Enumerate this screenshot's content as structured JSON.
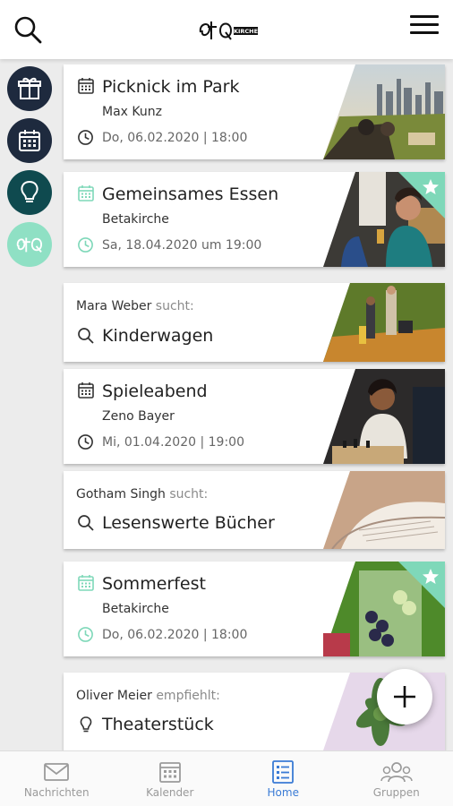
{
  "colors": {
    "accent": "#3a7bd5",
    "mint": "#7fd8b9",
    "navy": "#1e2a3e",
    "teal": "#0f4a4f",
    "logo_green": "#8fe0c4"
  },
  "header": {
    "search_icon": "search-icon",
    "logo_badge": "KIRCHE",
    "menu_icon": "menu-icon"
  },
  "rail": [
    {
      "icon": "gift-icon"
    },
    {
      "icon": "calendar-icon"
    },
    {
      "icon": "lightbulb-icon"
    },
    {
      "icon": "logo-icon"
    }
  ],
  "cards": {
    "picknick": {
      "title": "Picknick im Park",
      "subtitle": "Max Kunz",
      "when": "Do, 06.02.2020 | 18:00"
    },
    "essen": {
      "title": "Gemeinsames Essen",
      "subtitle": "Betakirche",
      "when": "Sa, 18.04.2020 um 19:00",
      "starred": true
    },
    "kinderwagen": {
      "author": "Mara Weber",
      "verb": "sucht:",
      "title": "Kinderwagen"
    },
    "spieleabend": {
      "title": "Spieleabend",
      "subtitle": "Zeno Bayer",
      "when": "Mi, 01.04.2020 | 19:00"
    },
    "buecher": {
      "author": "Gotham Singh",
      "verb": "sucht:",
      "title": "Lesenswerte Bücher"
    },
    "sommerfest": {
      "title": "Sommerfest",
      "subtitle": "Betakirche",
      "when": "Do, 06.02.2020 | 18:00",
      "starred": true
    },
    "theater": {
      "author": "Oliver Meier",
      "verb": "empfiehlt:",
      "title": "Theaterstück"
    }
  },
  "nav": {
    "nachrichten": "Nachrichten",
    "kalender": "Kalender",
    "home": "Home",
    "gruppen": "Gruppen"
  }
}
